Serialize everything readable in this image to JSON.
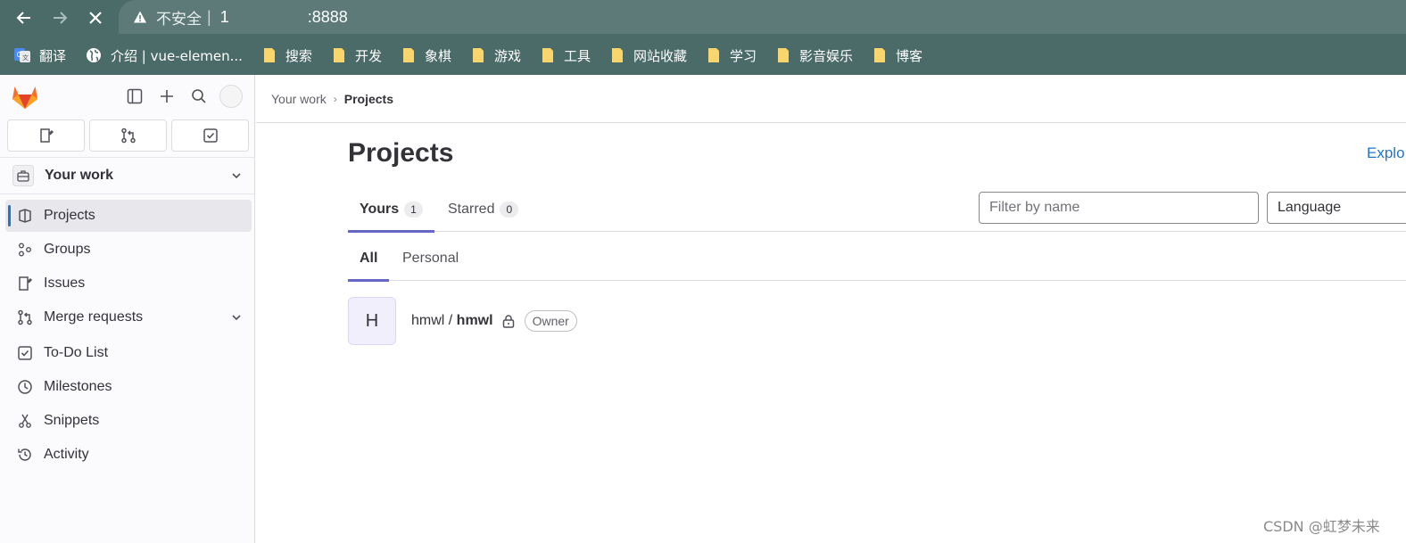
{
  "browser": {
    "back_icon": "arrow-left-icon",
    "forward_icon": "arrow-right-icon",
    "stop_icon": "close-icon",
    "security_icon": "warning-triangle-icon",
    "security_label": "不安全",
    "separator": "|",
    "url_start": "1",
    "url_end": ":8888"
  },
  "bookmarks": [
    {
      "label": "翻译",
      "icon": "google-translate-icon"
    },
    {
      "label": "介绍 | vue-elemen...",
      "icon": "globe-icon"
    },
    {
      "label": "搜索",
      "icon": "folder-icon"
    },
    {
      "label": "开发",
      "icon": "folder-icon"
    },
    {
      "label": "象棋",
      "icon": "folder-icon"
    },
    {
      "label": "游戏",
      "icon": "folder-icon"
    },
    {
      "label": "工具",
      "icon": "folder-icon"
    },
    {
      "label": "网站收藏",
      "icon": "folder-icon"
    },
    {
      "label": "学习",
      "icon": "folder-icon"
    },
    {
      "label": "影音娱乐",
      "icon": "folder-icon"
    },
    {
      "label": "博客",
      "icon": "folder-icon"
    }
  ],
  "sidebar": {
    "context_title": "Your work",
    "items": [
      {
        "label": "Projects",
        "icon": "project-icon"
      },
      {
        "label": "Groups",
        "icon": "group-icon"
      },
      {
        "label": "Issues",
        "icon": "issues-icon"
      },
      {
        "label": "Merge requests",
        "icon": "merge-request-icon"
      },
      {
        "label": "To-Do List",
        "icon": "todo-icon"
      },
      {
        "label": "Milestones",
        "icon": "clock-icon"
      },
      {
        "label": "Snippets",
        "icon": "snippet-icon"
      },
      {
        "label": "Activity",
        "icon": "history-icon"
      }
    ]
  },
  "breadcrumb": {
    "parent": "Your work",
    "separator": "›",
    "current": "Projects"
  },
  "page": {
    "title": "Projects",
    "explore_label": "Explo"
  },
  "tabs": {
    "yours_label": "Yours",
    "yours_count": "1",
    "starred_label": "Starred",
    "starred_count": "0"
  },
  "filter": {
    "placeholder": "Filter by name",
    "language_value": "Language"
  },
  "subtabs": {
    "all_label": "All",
    "personal_label": "Personal"
  },
  "projects": [
    {
      "avatar_letter": "H",
      "namespace": "hmwl / ",
      "name": "hmwl",
      "role": "Owner"
    }
  ],
  "watermark": "CSDN @虹梦未来",
  "colors": {
    "browser_bg": "#4b6b69",
    "accent_blue": "#1f75cb",
    "tab_underline": "#6666c4",
    "sidebar_bg": "#fbfafd"
  }
}
